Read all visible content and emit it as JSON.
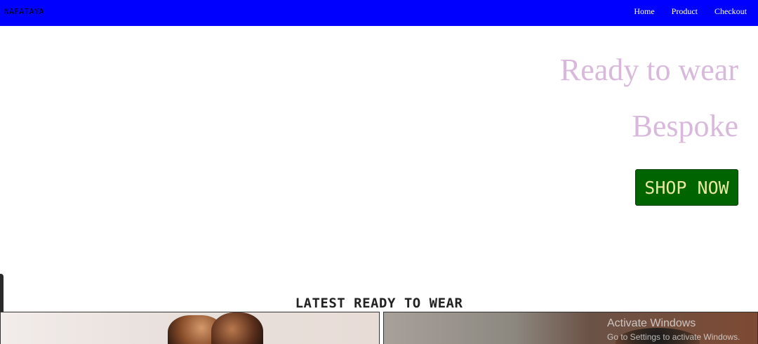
{
  "navbar": {
    "brand": "NAFATAYA",
    "links": [
      "Home",
      "Product",
      "Checkout"
    ],
    "background": "#0000ff"
  },
  "hero": {
    "line1": "Ready to wear",
    "line2": "Bespoke",
    "cta_label": "SHOP NOW",
    "text_color": "#d8b9dc",
    "cta_color": "#006400"
  },
  "section": {
    "title": "LATEST READY TO WEAR"
  },
  "watermark": {
    "title": "Activate Windows",
    "subtitle": "Go to Settings to activate Windows."
  }
}
